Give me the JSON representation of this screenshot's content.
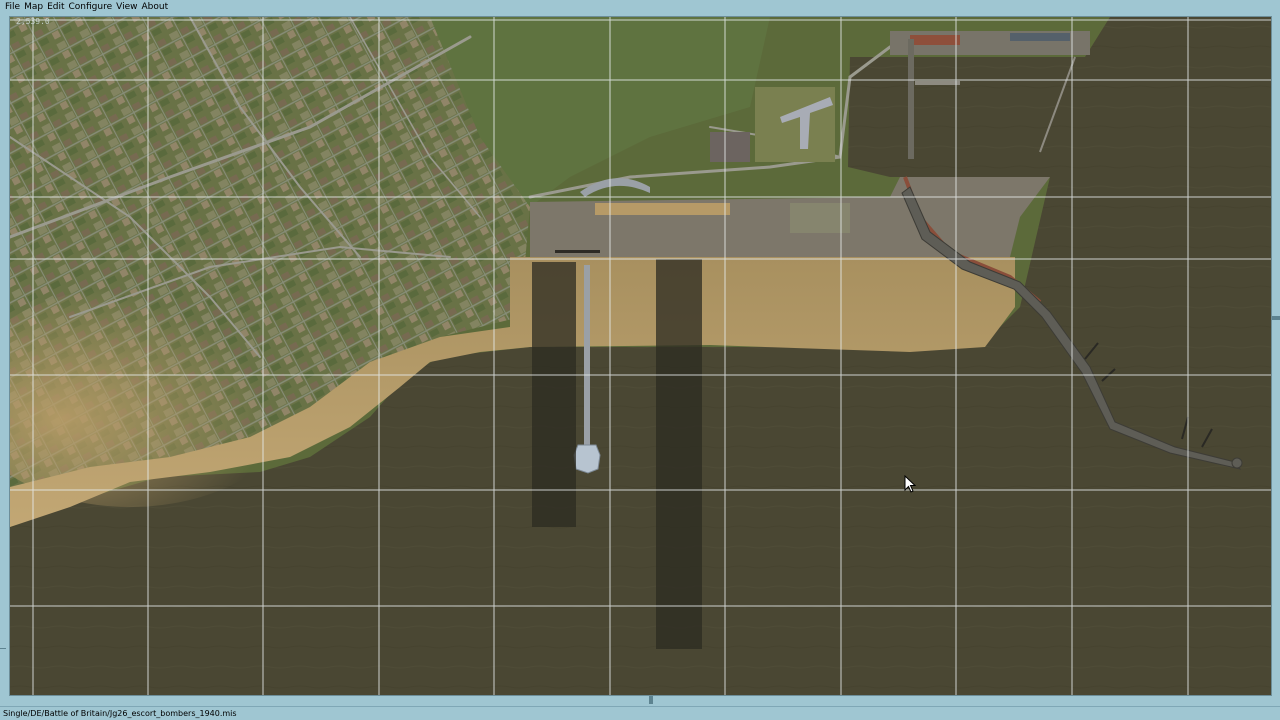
{
  "menu": {
    "items": [
      {
        "label": "File"
      },
      {
        "label": "Map"
      },
      {
        "label": "Edit"
      },
      {
        "label": "Configure"
      },
      {
        "label": "View"
      },
      {
        "label": "About"
      }
    ]
  },
  "map": {
    "coords_readout": "2,539.0",
    "colors": {
      "water": "#4a4733",
      "land": "#5d6b3b",
      "beach": "#b29766",
      "apron": "#7d776a",
      "grid": "#e8ecec",
      "shadow": "#2c2b22"
    }
  },
  "status": {
    "mission_path": "Single/DE/Battle of Britain/Jg26_escort_bombers_1940.mis"
  },
  "cursor": {
    "icon": "arrow-cursor-icon"
  }
}
